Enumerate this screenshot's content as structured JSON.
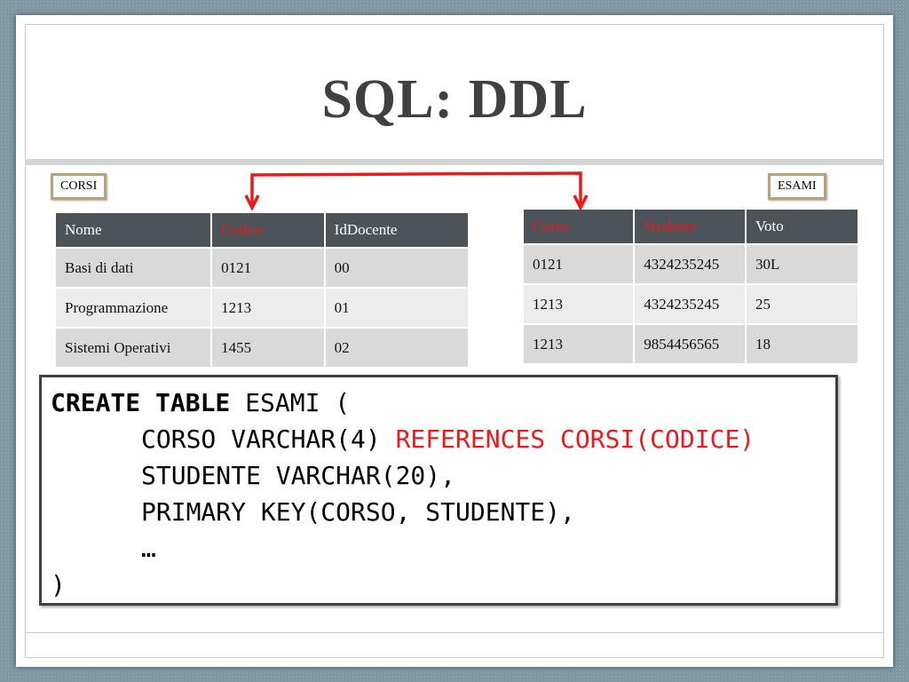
{
  "slide": {
    "title": "SQL: DDL"
  },
  "corsi": {
    "label": "CORSI",
    "columns": [
      "Nome",
      "Codice",
      "IdDocente"
    ],
    "rows": [
      [
        "Basi di dati",
        "0121",
        "00"
      ],
      [
        "Programmazione",
        "1213",
        "01"
      ],
      [
        "Sistemi Operativi",
        "1455",
        "02"
      ]
    ]
  },
  "esami": {
    "label": "ESAMI",
    "columns": [
      "Corso",
      "Studente",
      "Voto"
    ],
    "rows": [
      [
        "0121",
        "4324235245",
        "30L"
      ],
      [
        "1213",
        "4324235245",
        "25"
      ],
      [
        "1213",
        "9854456565",
        "18"
      ]
    ]
  },
  "code": {
    "line1_kw": "CREATE TABLE",
    "line1_rest": " ESAMI (",
    "line2_a": "CORSO VARCHAR(4) ",
    "line2_b": "REFERENCES CORSI(CODICE)",
    "line3": "STUDENTE VARCHAR(20),",
    "line4": "PRIMARY KEY(CORSO, STUDENTE),",
    "line5": "…",
    "line6": ")"
  },
  "colors": {
    "key_highlight": "#e81a1a",
    "header_bg": "#4d5459",
    "label_border": "#b5a278"
  }
}
